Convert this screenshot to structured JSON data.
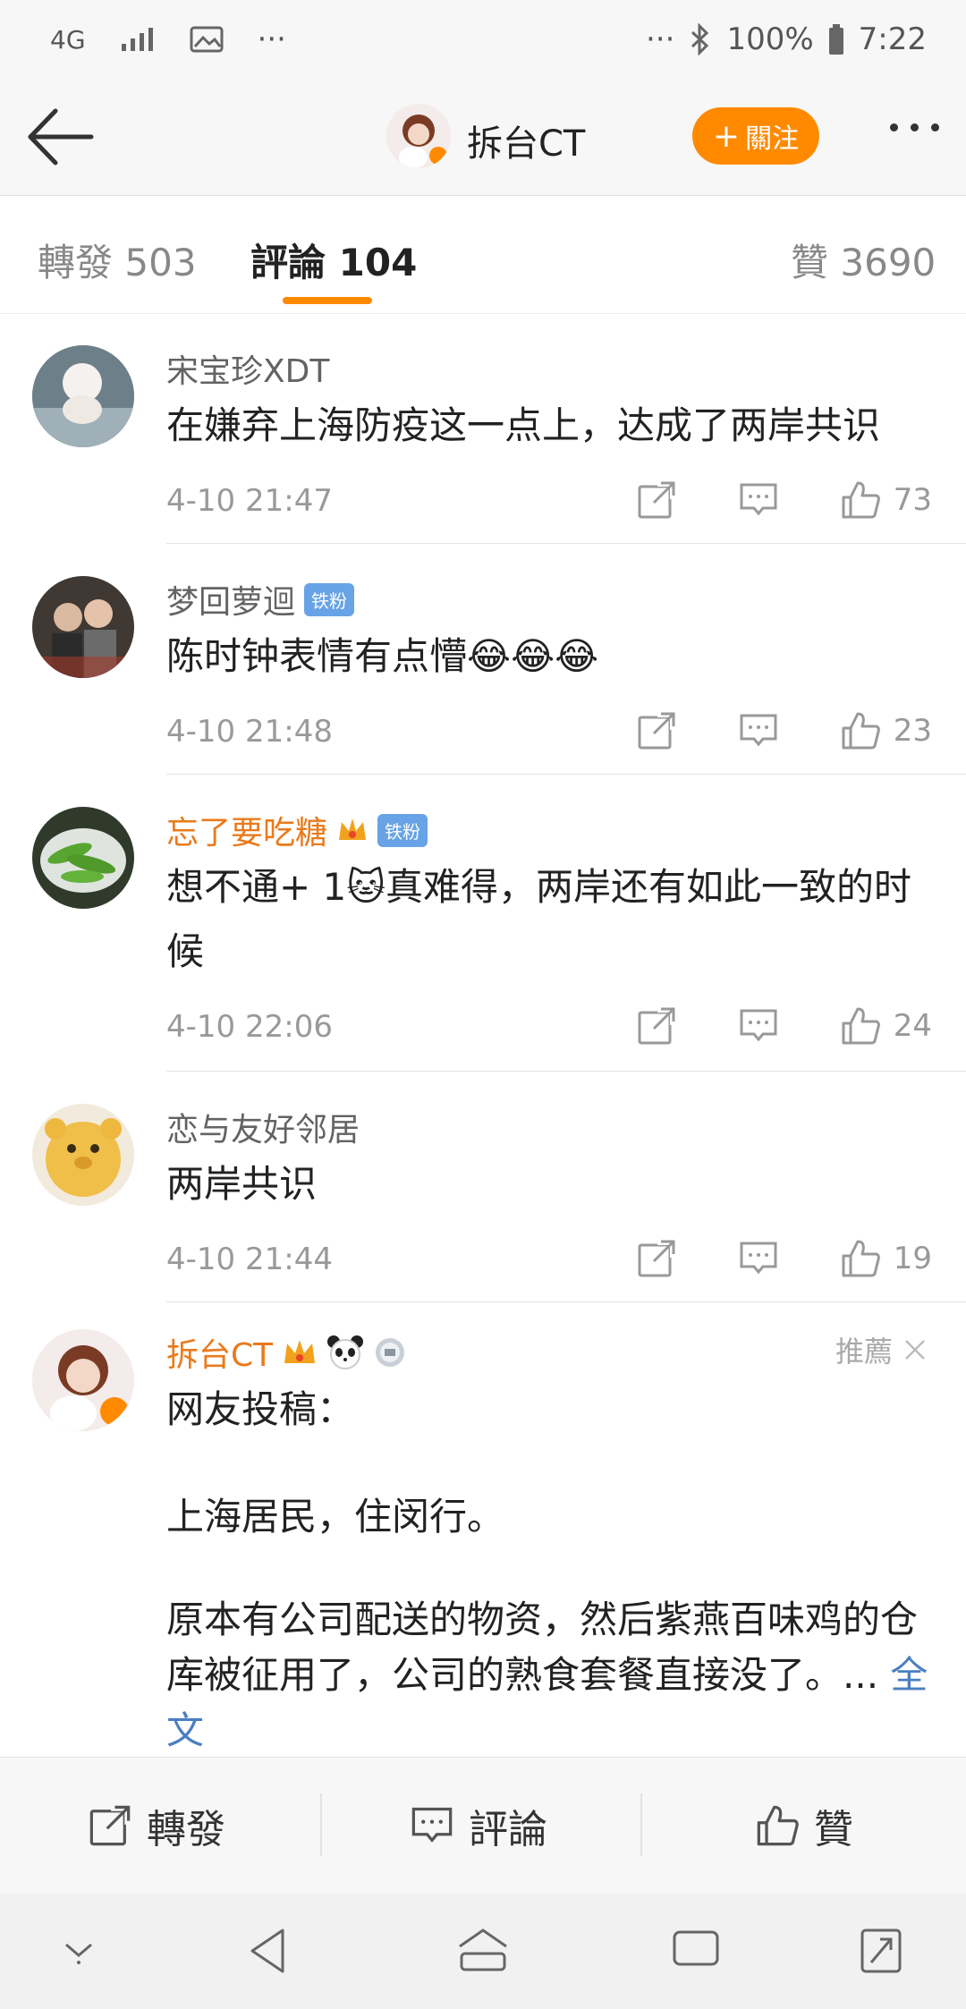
{
  "status_bar": {
    "network": "4G",
    "battery": "100%",
    "time": "7:22",
    "dots": "···"
  },
  "nav": {
    "title": "拆台CT",
    "follow_label": "關注",
    "follow_plus": "+"
  },
  "tabs": {
    "repost": {
      "label": "轉發",
      "count": "503"
    },
    "comment": {
      "label": "評論",
      "count": "104"
    },
    "like": {
      "label": "贊",
      "count": "3690"
    }
  },
  "comments": [
    {
      "name": "宋宝珍XDT",
      "text": "在嫌弃上海防疫这一点上，达成了两岸共识",
      "time": "4-10 21:47",
      "likes": "73"
    },
    {
      "name": "梦回萝迴",
      "badge": "铁粉",
      "text": "陈时钟表情有点懵😂😂😂",
      "time": "4-10 21:48",
      "likes": "23"
    },
    {
      "name": "忘了要吃糖",
      "badge": "铁粉",
      "text": "想不通+ 1🐱真难得，两岸还有如此一致的时候",
      "time": "4-10 22:06",
      "likes": "24"
    },
    {
      "name": "恋与友好邻居",
      "text": "两岸共识",
      "time": "4-10 21:44",
      "likes": "19"
    }
  ],
  "post": {
    "name": "拆台CT",
    "recommend_label": "推薦",
    "line1": "网友投稿：",
    "line2": "上海居民，住闵行。",
    "line3": "原本有公司配送的物资，然后紫燕百味鸡的仓库被征用了，公司的熟食套餐直接没了。...",
    "full_text_link": "全文"
  },
  "bottom_bar": {
    "repost": "轉發",
    "comment": "評論",
    "like": "贊"
  },
  "colors": {
    "accent": "#ff8a00",
    "link": "#4a7fc1",
    "fan_badge": "#67a3e6"
  }
}
